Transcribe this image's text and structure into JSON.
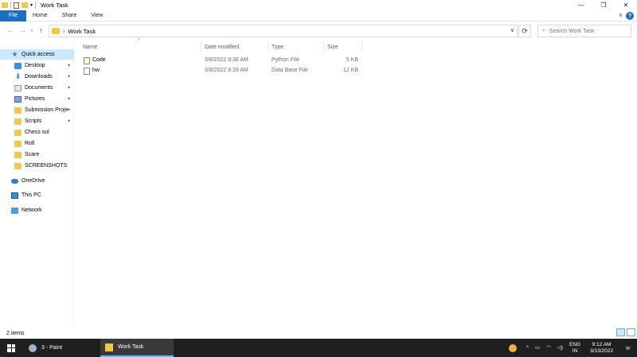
{
  "window": {
    "title": "Work Task",
    "controls": {
      "minimize": "—",
      "maximize": "❐",
      "close": "✕"
    }
  },
  "ribbon": {
    "tabs": [
      "File",
      "Home",
      "Share",
      "View"
    ],
    "help": "?",
    "expand": "∨"
  },
  "nav": {
    "back": "←",
    "forward": "→",
    "recent": "∨",
    "up": "↑",
    "path": [
      "Work Task"
    ],
    "refresh": "⟳",
    "search_placeholder": "Search Work Task"
  },
  "sidebar": {
    "items": [
      {
        "label": "Quick access",
        "icon": "star-icon",
        "selected": true
      },
      {
        "label": "Desktop",
        "icon": "desktop-icon",
        "pinned": true
      },
      {
        "label": "Downloads",
        "icon": "download-icon",
        "pinned": true
      },
      {
        "label": "Documents",
        "icon": "documents-icon",
        "pinned": true
      },
      {
        "label": "Pictures",
        "icon": "pictures-icon",
        "pinned": true
      },
      {
        "label": "Submission Proje",
        "icon": "folder-icon",
        "pinned": true
      },
      {
        "label": "Scripts",
        "icon": "folder-icon",
        "pinned": true
      },
      {
        "label": "Chess sol",
        "icon": "folder-icon"
      },
      {
        "label": "Roll",
        "icon": "folder-icon"
      },
      {
        "label": "Scare",
        "icon": "folder-icon"
      },
      {
        "label": "SCREENSHOTS",
        "icon": "folder-icon"
      },
      {
        "label": "OneDrive",
        "icon": "onedrive-icon"
      },
      {
        "label": "This PC",
        "icon": "computer-icon"
      },
      {
        "label": "Network",
        "icon": "network-icon"
      }
    ],
    "pin_glyph": "📌"
  },
  "columns": {
    "name": "Name",
    "date": "Date modified",
    "type": "Type",
    "size": "Size",
    "sort_glyph": "^"
  },
  "files": [
    {
      "name": "Code",
      "date": "3/8/2022 8:38 AM",
      "type": "Python File",
      "size": "5 KB",
      "icon": "python-file-icon"
    },
    {
      "name": "hw",
      "date": "3/8/2022 8:39 AM",
      "type": "Data Base File",
      "size": "12 KB",
      "icon": "database-file-icon"
    }
  ],
  "status": {
    "count": "2 items"
  },
  "taskbar": {
    "apps": [
      {
        "label": "3 - Paint",
        "icon": "paint-icon"
      },
      {
        "label": "Work Task",
        "icon": "folder-icon",
        "active": true
      }
    ],
    "tray": {
      "chevron": "^",
      "lang1": "ENG",
      "lang2": "IN",
      "time": "9:12 AM",
      "date": "3/13/2022",
      "notifications": "2"
    }
  },
  "colors": {
    "accent": "#1a6fc1",
    "selection": "#cce8ff",
    "taskbar": "#1f1f1f",
    "folder": "#f2c84b"
  }
}
